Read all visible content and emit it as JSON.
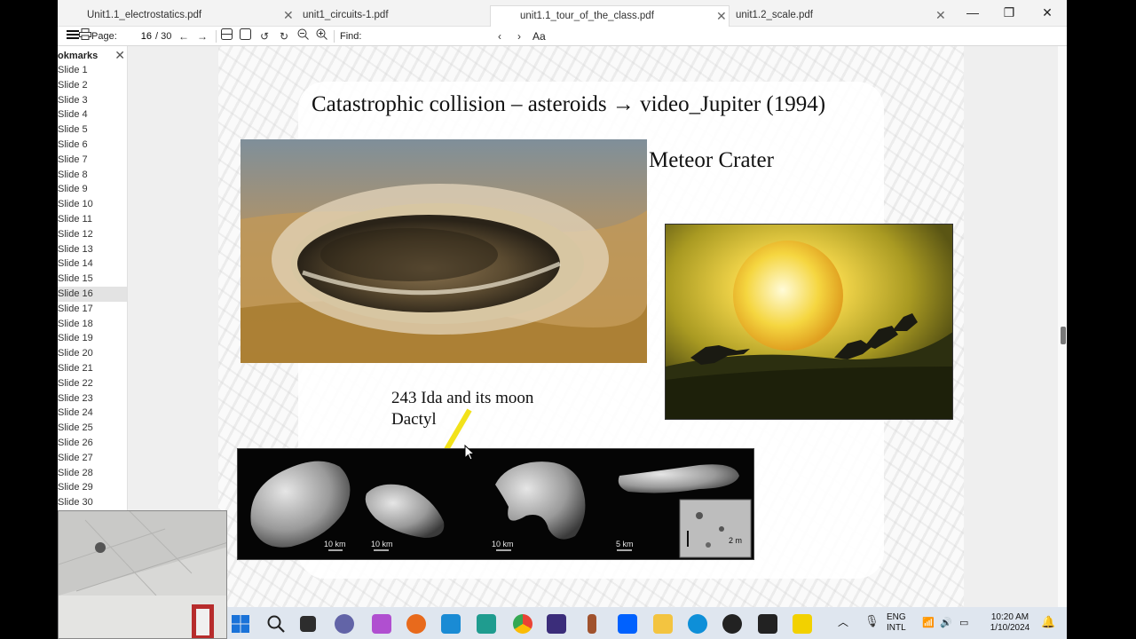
{
  "tabs": [
    {
      "label": "Unit1.1_electrostatics.pdf",
      "active": false
    },
    {
      "label": "unit1_circuits-1.pdf",
      "active": false
    },
    {
      "label": "unit1.1_tour_of_the_class.pdf",
      "active": true
    },
    {
      "label": "unit1.2_scale.pdf",
      "active": false
    }
  ],
  "toolbar": {
    "page_label": "Page:",
    "page_value": "16",
    "page_total": "/ 30",
    "find_label": "Find:",
    "case_label": "Aa"
  },
  "sidebar": {
    "title": "okmarks",
    "items": [
      "Slide 1",
      "Slide 2",
      "Slide 3",
      "Slide 4",
      "Slide 5",
      "Slide 6",
      "Slide 7",
      "Slide 8",
      "Slide 9",
      "Slide 10",
      "Slide 11",
      "Slide 12",
      "Slide 13",
      "Slide 14",
      "Slide 15",
      "Slide 16",
      "Slide 17",
      "Slide 18",
      "Slide 19",
      "Slide 20",
      "Slide 21",
      "Slide 22",
      "Slide 23",
      "Slide 24",
      "Slide 25",
      "Slide 26",
      "Slide 27",
      "Slide 28",
      "Slide 29",
      "Slide 30"
    ],
    "active_index": 15
  },
  "slide": {
    "title": "Catastrophic collision – asteroids → video_Jupiter (1994)",
    "crater_label": "Meteor Crater",
    "ida_label_line1": "243 Ida and its moon",
    "ida_label_line2": "Dactyl",
    "scale_labels": [
      "10 km",
      "10 km",
      "10 km",
      "5 km",
      "2 m"
    ]
  },
  "taskbar": {
    "lang_line1": "ENG",
    "lang_line2": "INTL",
    "time": "10:20 AM",
    "date": "1/10/2024"
  },
  "colors": {
    "accent_arrow": "#f2e21a",
    "taskbar_bg": "#dfe6ef"
  }
}
